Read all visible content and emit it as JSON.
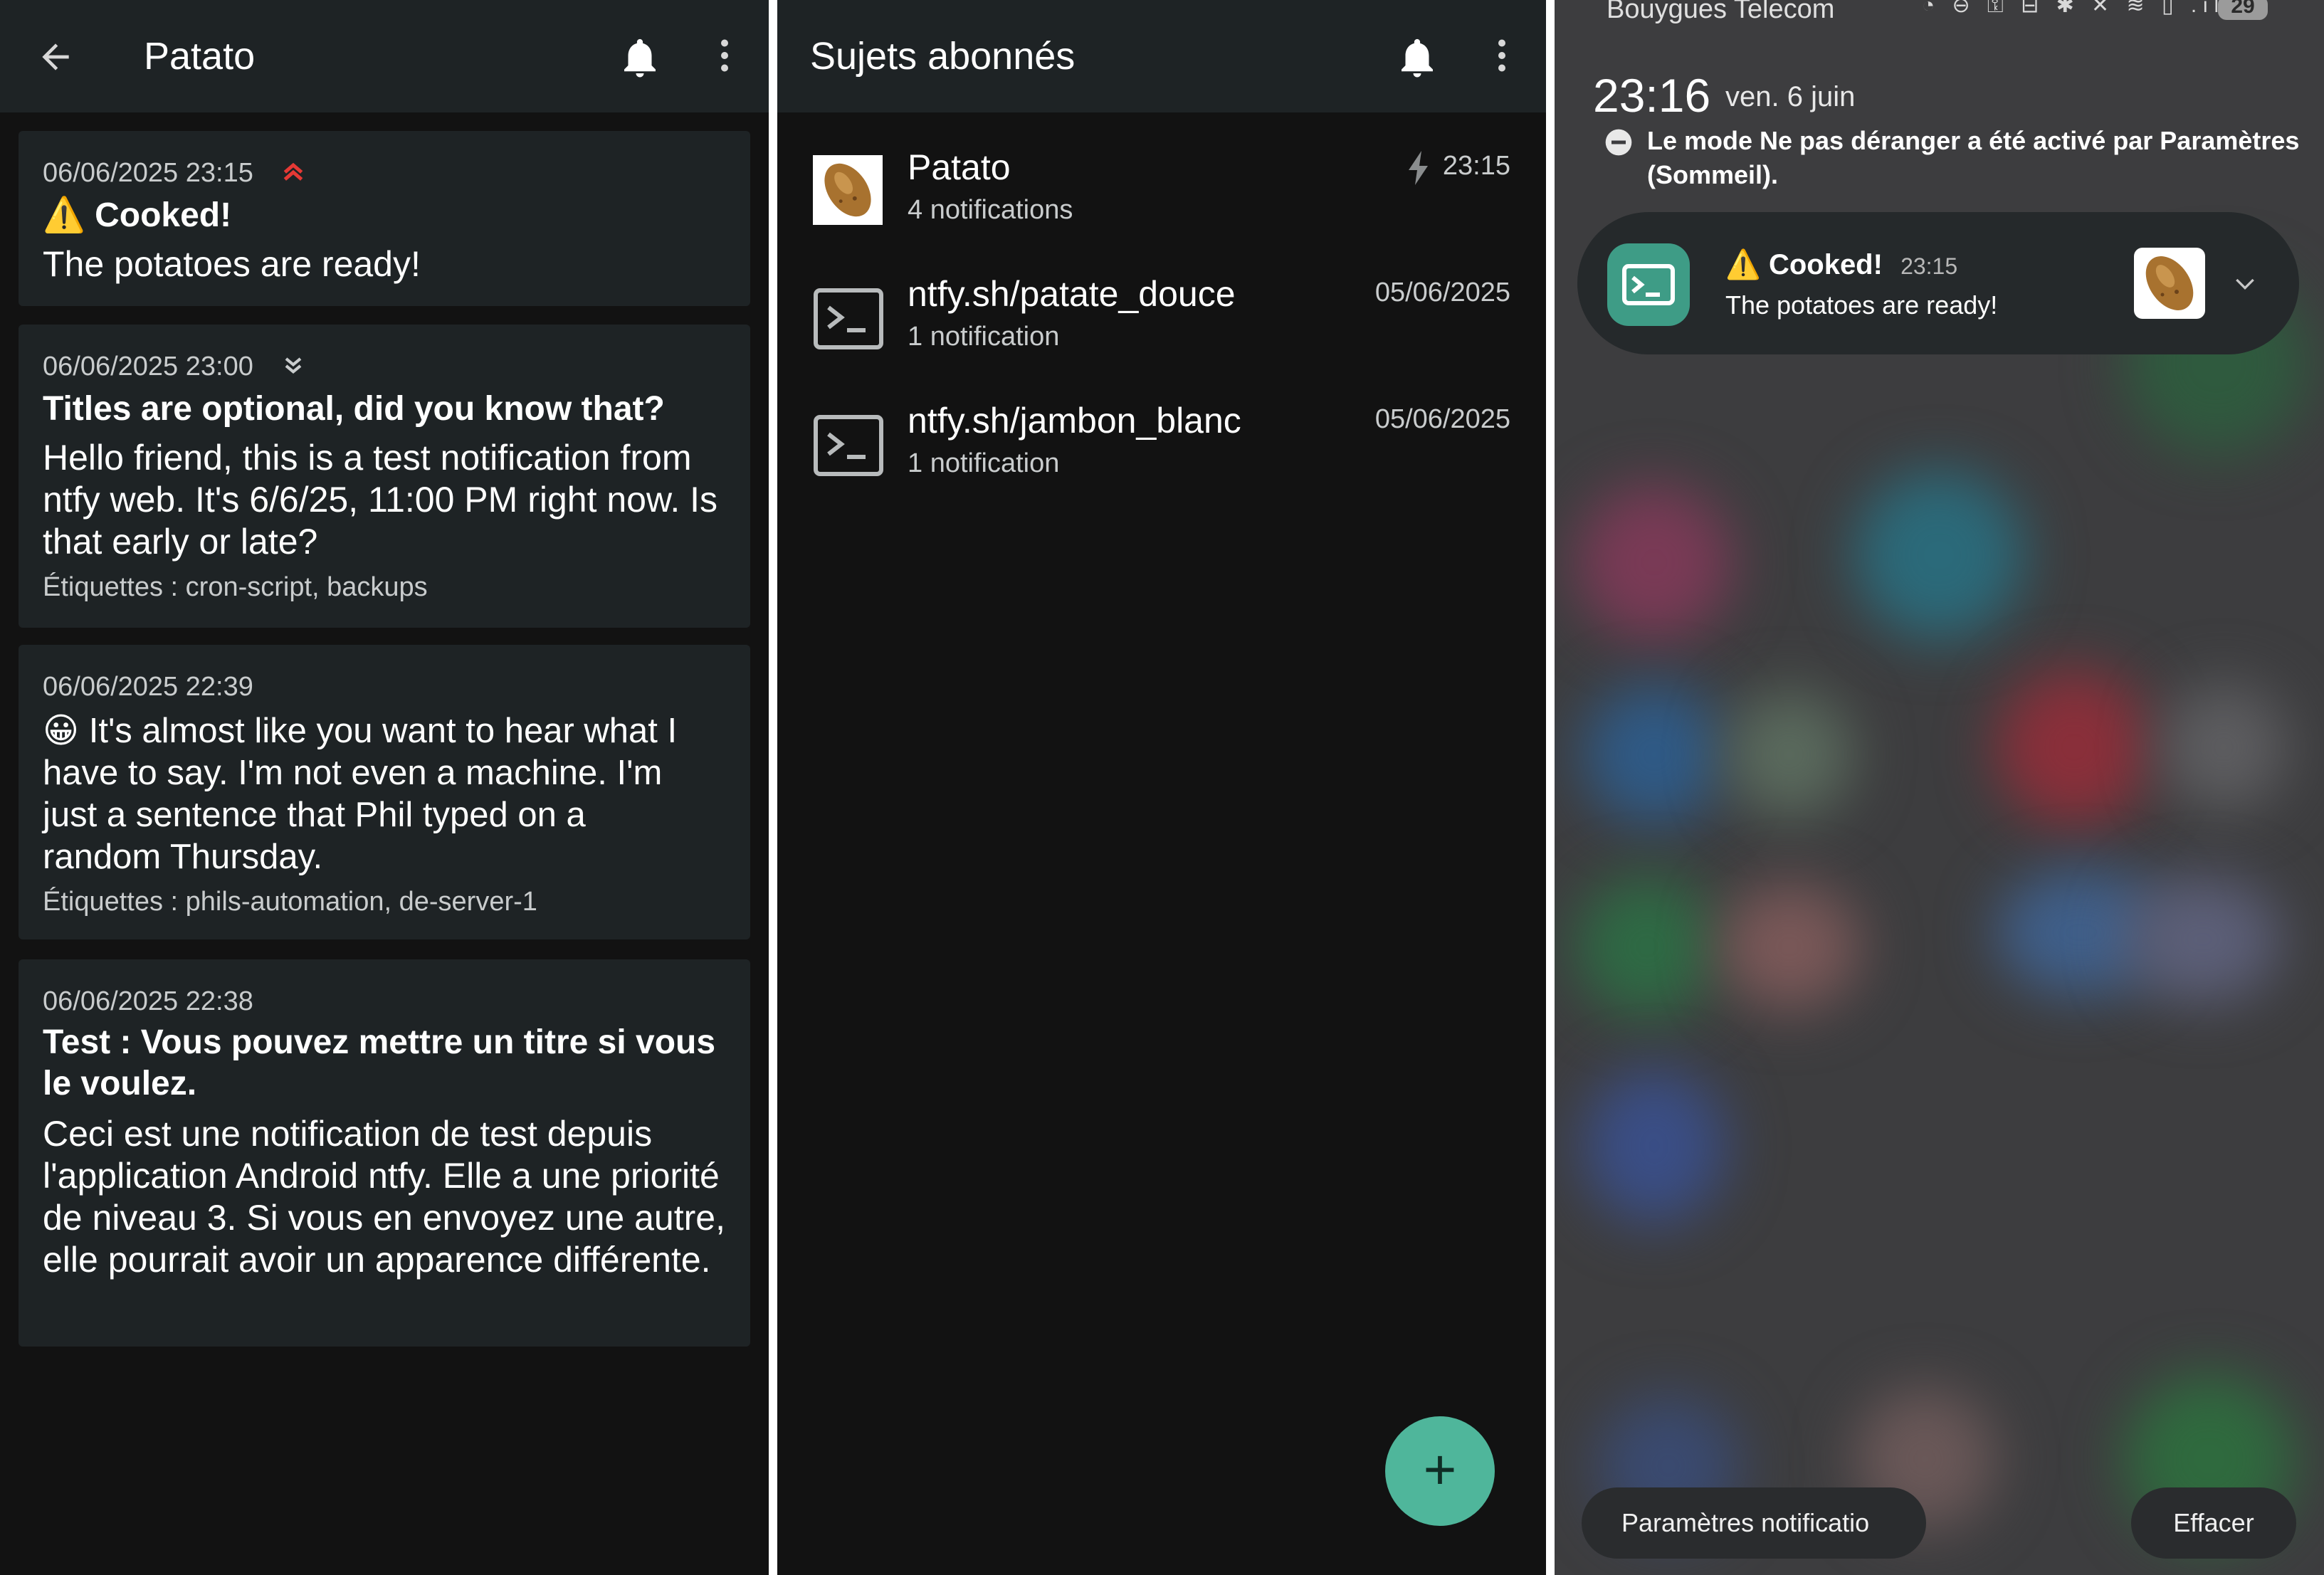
{
  "colors": {
    "accent": "#4fb69b",
    "priority_high": "#e53935",
    "card_bg": "#1e2325",
    "app_bg": "#121212"
  },
  "topic_view": {
    "title": "Patato",
    "back_icon": "arrow-back-icon",
    "bell_icon": "bell-icon",
    "menu_icon": "more-vert-icon",
    "messages": [
      {
        "date": "06/06/2025 23:15",
        "priority_icon": "priority-high-icon",
        "title_emoji": "⚠️",
        "title": "Cooked!",
        "body": "The potatoes are ready!"
      },
      {
        "date": "06/06/2025 23:00",
        "priority_icon": "priority-low-icon",
        "title": "Titles are optional, did you know that?",
        "body": "Hello friend, this is a test notification from ntfy web. It's 6/6/25, 11:00 PM right now. Is that early or late?",
        "tags": "Étiquettes : cron-script, backups"
      },
      {
        "date": "06/06/2025 22:39",
        "body_emoji": "😀",
        "body": "It's almost like you want to hear what I have to say. I'm not even a machine. I'm just a sentence that Phil typed on a random Thursday.",
        "tags": "Étiquettes : phils-automation, de-server-1"
      },
      {
        "date": "06/06/2025 22:38",
        "title": "Test : Vous pouvez mettre un titre si vous le voulez.",
        "body": "Ceci est une notification de test depuis l'application Android ntfy. Elle a une priorité de niveau 3. Si vous en envoyez une autre, elle pourrait avoir un apparence différente."
      }
    ]
  },
  "subscriptions_view": {
    "title": "Sujets abonnés",
    "bell_icon": "bell-icon",
    "menu_icon": "more-vert-icon",
    "items": [
      {
        "name": "Patato",
        "count": "4 notifications",
        "time": "23:15",
        "icon": "potato-icon",
        "instant_icon": "bolt-icon"
      },
      {
        "name": "ntfy.sh/patate_douce",
        "count": "1 notification",
        "time": "05/06/2025",
        "icon": "terminal-icon"
      },
      {
        "name": "ntfy.sh/jambon_blanc",
        "count": "1 notification",
        "time": "05/06/2025",
        "icon": "terminal-icon"
      }
    ],
    "fab_label": "+"
  },
  "notification_shade": {
    "carrier": "Bouygues Telecom",
    "battery": "29",
    "time": "23:16",
    "date": "ven. 6 juin",
    "dnd_text": "Le mode Ne pas déranger a été activé par Paramètres (Sommeil).",
    "notification": {
      "title_emoji": "⚠️",
      "title": "Cooked!",
      "time": "23:15",
      "body": "The potatoes are ready!"
    },
    "settings_button": "Paramètres notificatio",
    "clear_button": "Effacer"
  }
}
